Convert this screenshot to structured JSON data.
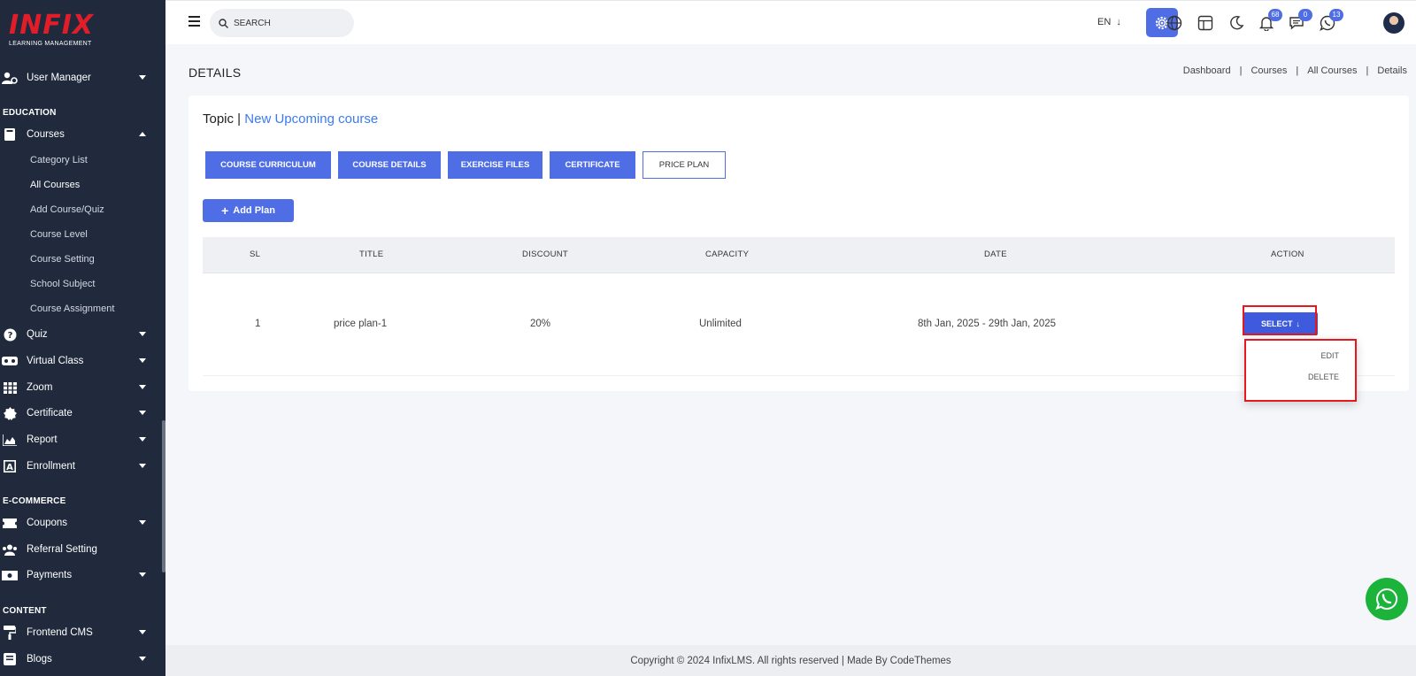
{
  "app": {
    "logo_text": "INFIX",
    "logo_tagline": "LEARNING MANAGEMENT"
  },
  "sidebar": {
    "user_manager": "User Manager",
    "section_education": "EDUCATION",
    "courses": "Courses",
    "courses_sub": [
      "Category List",
      "All Courses",
      "Add Course/Quiz",
      "Course Level",
      "Course Setting",
      "School Subject",
      "Course Assignment"
    ],
    "quiz": "Quiz",
    "virtual_class": "Virtual Class",
    "zoom": "Zoom",
    "certificate": "Certificate",
    "report": "Report",
    "enrollment": "Enrollment",
    "section_ecommerce": "E-COMMERCE",
    "coupons": "Coupons",
    "referral_setting": "Referral Setting",
    "payments": "Payments",
    "section_content": "CONTENT",
    "frontend_cms": "Frontend CMS",
    "blogs": "Blogs"
  },
  "topbar": {
    "search_placeholder": "SEARCH",
    "language": "EN",
    "notification_count": "68",
    "message_count": "0",
    "whatsapp_count": "13"
  },
  "page": {
    "title": "DETAILS",
    "breadcrumbs": [
      "Dashboard",
      "Courses",
      "All Courses",
      "Details"
    ]
  },
  "course": {
    "topic_label": "Topic |",
    "topic_name": "New Upcoming course",
    "tabs": [
      "COURSE CURRICULUM",
      "COURSE DETAILS",
      "EXERCISE FILES",
      "CERTIFICATE",
      "PRICE PLAN"
    ],
    "add_plan_label": "Add Plan"
  },
  "table": {
    "headers": [
      "SL",
      "TITLE",
      "DISCOUNT",
      "CAPACITY",
      "DATE",
      "ACTION"
    ],
    "rows": [
      {
        "sl": "1",
        "title": "price plan-1",
        "discount": "20%",
        "capacity": "Unlimited",
        "date": "8th Jan, 2025 - 29th Jan, 2025"
      }
    ],
    "select_label": "SELECT",
    "menu_items": [
      "EDIT",
      "DELETE"
    ]
  },
  "footer": {
    "text": "Copyright © 2024 InfixLMS. All rights reserved | Made By CodeThemes"
  },
  "colors": {
    "sidebar_bg": "#202a3c",
    "accent": "#4f6ee6",
    "highlight": "#e5181e",
    "whatsapp": "#1bb33a"
  }
}
